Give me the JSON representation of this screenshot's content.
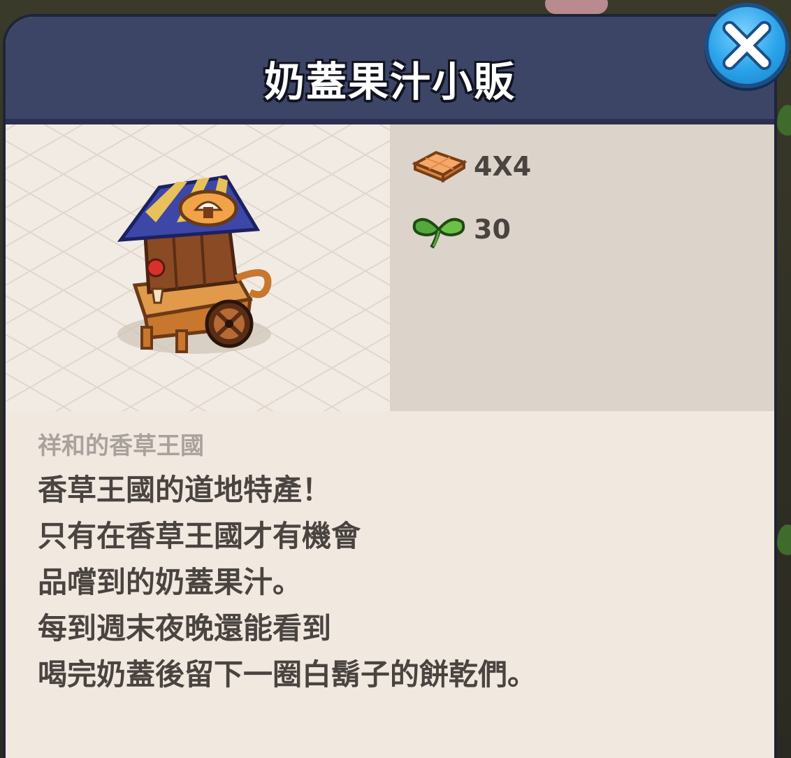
{
  "dialog": {
    "title": "奶蓋果汁小販",
    "close_icon": "close-x-icon",
    "accent_color": "#3d4567"
  },
  "item": {
    "image_icon": "juice-cart-icon",
    "size_icon": "tile-size-icon",
    "size_value": "4X4",
    "points_icon": "clover-icon",
    "points_value": "30"
  },
  "description": {
    "category": "祥和的香草王國",
    "lines": [
      "香草王國的道地特產！",
      "只有在香草王國才有機會",
      "品嚐到的奶蓋果汁。",
      "每到週末夜晚還能看到",
      "喝完奶蓋後留下一圈白鬍子的餅乾們。"
    ]
  }
}
